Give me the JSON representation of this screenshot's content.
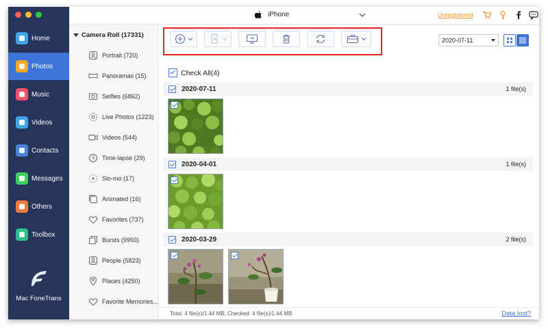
{
  "device": {
    "name": "iPhone"
  },
  "topbar": {
    "unregistered_label": "Unregistered"
  },
  "nav": {
    "items": [
      {
        "label": "Home",
        "color": "#3fa5e8",
        "icon": "home-icon"
      },
      {
        "label": "Photos",
        "color": "#f5a623",
        "icon": "photo-icon"
      },
      {
        "label": "Music",
        "color": "#f0526c",
        "icon": "music-icon"
      },
      {
        "label": "Videos",
        "color": "#3fa5e8",
        "icon": "video-icon"
      },
      {
        "label": "Contacts",
        "color": "#4a82d8",
        "icon": "contacts-icon"
      },
      {
        "label": "Messages",
        "color": "#3ccf5a",
        "icon": "messages-icon"
      },
      {
        "label": "Others",
        "color": "#f07b3b",
        "icon": "others-icon"
      },
      {
        "label": "Toolbox",
        "color": "#2bbf8e",
        "icon": "toolbox-icon"
      }
    ],
    "active_index": 1,
    "brand": "Mac FoneTrans"
  },
  "categories": {
    "header": "Camera Roll (17331)",
    "items": [
      {
        "label": "Portrait (720)",
        "icon": "portrait-icon"
      },
      {
        "label": "Panoramas (15)",
        "icon": "panorama-icon"
      },
      {
        "label": "Selfies (6862)",
        "icon": "selfie-icon"
      },
      {
        "label": "Live Photos (1223)",
        "icon": "live-photo-icon"
      },
      {
        "label": "Videos (544)",
        "icon": "video-icon"
      },
      {
        "label": "Time-lapse (29)",
        "icon": "time-lapse-icon"
      },
      {
        "label": "Slo-mo (17)",
        "icon": "slo-mo-icon"
      },
      {
        "label": "Animated (16)",
        "icon": "animated-icon"
      },
      {
        "label": "Favorites (737)",
        "icon": "heart-icon"
      },
      {
        "label": "Bursts (9993)",
        "icon": "burst-icon"
      },
      {
        "label": "People (5823)",
        "icon": "people-icon"
      },
      {
        "label": "Places (4250)",
        "icon": "place-icon"
      },
      {
        "label": "Favorite Memories...",
        "icon": "favorite-memories-icon"
      }
    ]
  },
  "toolbar": {
    "tools": [
      {
        "name": "add",
        "icon": "add-icon",
        "dropdown": true
      },
      {
        "name": "export-to-device",
        "icon": "phone-export-icon",
        "dropdown": true
      },
      {
        "name": "export-to-pc",
        "icon": "monitor-icon",
        "dropdown": false
      },
      {
        "name": "delete",
        "icon": "trash-icon",
        "dropdown": false
      },
      {
        "name": "refresh",
        "icon": "refresh-icon",
        "dropdown": false
      },
      {
        "name": "toolbox",
        "icon": "toolbox-icon",
        "dropdown": true
      }
    ],
    "date_filter": "2020-07-11"
  },
  "check_all_label": "Check All(4)",
  "groups": [
    {
      "date": "2020-07-11",
      "count": "1 file(s)",
      "photos": [
        "green-leaves-photo"
      ]
    },
    {
      "date": "2020-04-01",
      "count": "1 file(s)",
      "photos": [
        "green-leaves-photo"
      ]
    },
    {
      "date": "2020-03-29",
      "count": "2 file(s)",
      "photos": [
        "plant-photo",
        "potted-plant-photo"
      ]
    }
  ],
  "status": {
    "summary": "Total: 4 file(s)/1.44 MB; Checked: 4 file(s)/1.44 MB",
    "data_lost": "Data lost?"
  },
  "colors": {
    "accent": "#3f74d9",
    "nav_bg": "#27355a",
    "highlight_border": "#e32222",
    "unregistered": "#f0922d"
  }
}
